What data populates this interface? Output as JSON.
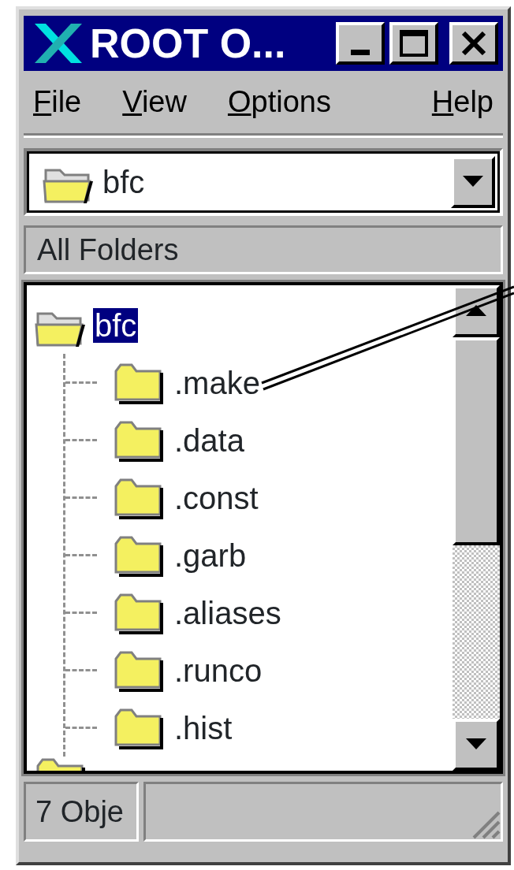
{
  "window": {
    "title": "ROOT O..."
  },
  "menu": [
    {
      "key": "F",
      "rest": "ile"
    },
    {
      "key": "V",
      "rest": "iew"
    },
    {
      "key": "O",
      "rest": "ptions"
    },
    {
      "key": "H",
      "rest": "elp"
    }
  ],
  "combo": {
    "value": "bfc"
  },
  "pane_header": "All Folders",
  "tree": {
    "label": "bfc",
    "selected": true,
    "expanded": true,
    "children": [
      {
        "label": ".make",
        "selected": false
      },
      {
        "label": ".data",
        "selected": false
      },
      {
        "label": ".const",
        "selected": false
      },
      {
        "label": ".garb",
        "selected": false
      },
      {
        "label": ".aliases",
        "selected": false
      },
      {
        "label": ".runco",
        "selected": false
      },
      {
        "label": ".hist",
        "selected": false
      }
    ]
  },
  "status_bar": [
    "7 Obje"
  ]
}
